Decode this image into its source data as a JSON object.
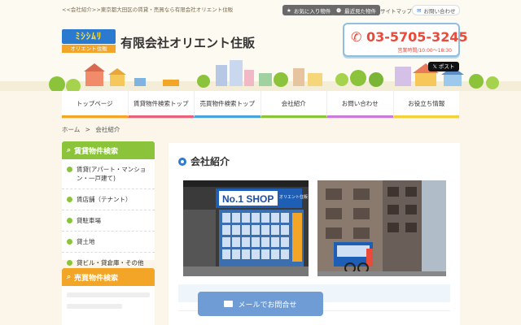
{
  "header": {
    "tagline": "<<会社紹介>>東京都大田区の賃貸・売買なら有限会社オリエント住販",
    "utility": {
      "favorites": "お気に入り物件",
      "recent": "最近見た物件",
      "sitemap": "サイトマップ",
      "contact": "お問い合わせ"
    },
    "logo": {
      "top": "ﾐｼｼﾑﾘ",
      "bottom": "オリエント住販"
    },
    "company_name": "有限会社オリエント住販",
    "phone": "03-5705-3245",
    "hours": "営業時間/10:00～18:30",
    "post_label": "ポスト"
  },
  "nav": {
    "items": [
      "トップページ",
      "賃貸物件検索トップ",
      "売買物件検索トップ",
      "会社紹介",
      "お問い合わせ",
      "お役立ち情報"
    ]
  },
  "colors": {
    "nav_underlines": [
      "#f2a526",
      "#e9627a",
      "#4aa3df",
      "#8bc43a",
      "#c77dd8",
      "#f2d23a"
    ],
    "rent_green": "#8bc43a",
    "sale_orange": "#f2a526",
    "phone_red": "#e94a3a"
  },
  "breadcrumb": {
    "home": "ホーム",
    "sep": ">",
    "current": "会社紹介"
  },
  "sidebar": {
    "rent_title": "賃貸物件検索",
    "rent_items": [
      "賃貸(アパート・マンション・一戸建て)",
      "賃店舗（テナント）",
      "貸駐車場",
      "貸土地",
      "貸ビル・貸倉庫・その他"
    ],
    "sale_title": "売買物件検索"
  },
  "main": {
    "title": "会社紹介",
    "photo1_sign": "No.1 SHOP",
    "photo1_sign_sub": "オリエント住販"
  },
  "mail_button": "メールでお問合せ"
}
